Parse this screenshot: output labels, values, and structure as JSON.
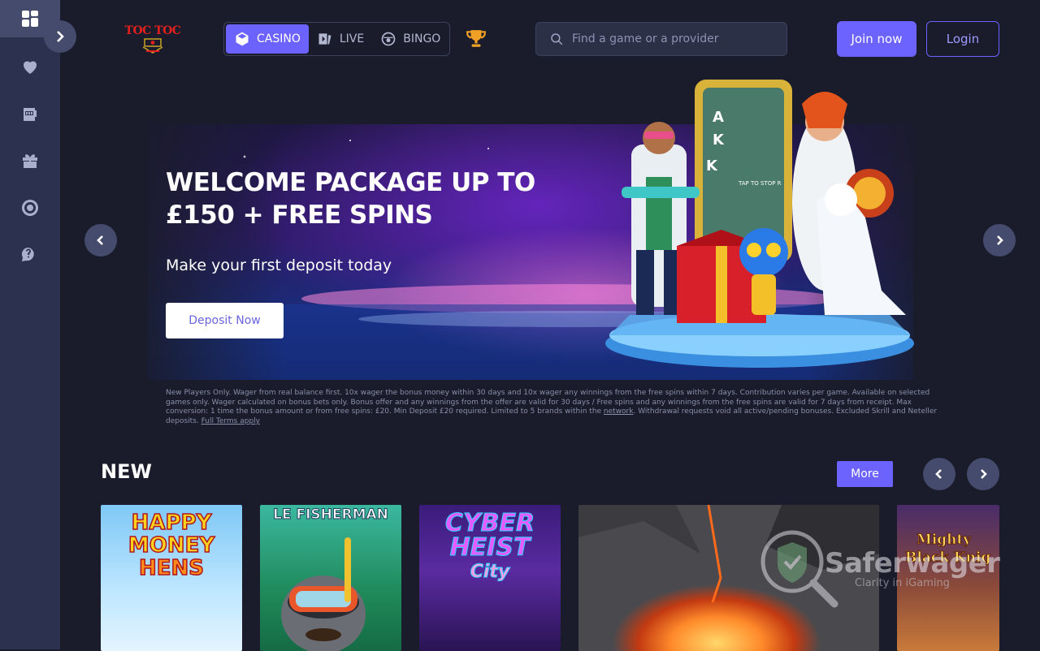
{
  "sidebar": {
    "items": [
      {
        "icon": "grid-icon"
      },
      {
        "icon": "heart-icon"
      },
      {
        "icon": "slot-machine-icon"
      },
      {
        "icon": "gift-icon"
      },
      {
        "icon": "target-icon"
      },
      {
        "icon": "help-chat-icon"
      }
    ],
    "toggle_icon": "chevron-right-icon"
  },
  "header": {
    "logo_text": "TOC TOC",
    "tabs": [
      {
        "label": "CASINO",
        "icon": "dice-icon"
      },
      {
        "label": "LIVE",
        "icon": "live-cards-icon"
      },
      {
        "label": "BINGO",
        "icon": "bingo-ball-icon"
      }
    ],
    "trophy_icon": "trophy-icon",
    "search": {
      "placeholder": "Find a game or a provider"
    },
    "join_label": "Join now",
    "login_label": "Login"
  },
  "banner": {
    "title_line1": "WELCOME PACKAGE UP TO",
    "title_line2": "£150 + FREE SPINS",
    "subtitle": "Make your first deposit today",
    "cta": "Deposit Now",
    "phone_reels": [
      "A",
      "K",
      "K"
    ],
    "phone_text": "TAP TO STOP R"
  },
  "terms": {
    "text_part1": "New Players Only. Wager from real balance first. 10x wager the bonus money within 30 days and 10x wager any winnings from the free spins within 7 days. Contribution varies per game. Available on selected games only. Wager calculated on bonus bets only. Bonus offer and any winnings from the offer are valid for 30 days / Free spins and any winnings from the free spins are valid for 7 days from receipt. Max conversion: 1 time the bonus amount or from free spins: £20. Min Deposit £20 required. Limited to 5 brands within the ",
    "link_network": "network",
    "text_part2": ". Withdrawal requests void all active/pending bonuses. Excluded Skrill and Neteller deposits. ",
    "link_terms": "Full Terms apply"
  },
  "new_section": {
    "title": "NEW",
    "more_label": "More",
    "games": [
      {
        "title_line1": "HAPPY",
        "title_line2": "MONEY",
        "title_line3": "HENS"
      },
      {
        "title": "LE FISHERMAN"
      },
      {
        "title_line1": "CYBER",
        "title_line2": "HEIST",
        "title_line3": "City"
      },
      {
        "title": ""
      },
      {
        "title_line1": "Mighty",
        "title_line2": "Black Knig"
      }
    ]
  },
  "watermark": {
    "name": "Saferwager",
    "tagline": "Clarity in iGaming"
  },
  "colors": {
    "accent": "#6c63ff",
    "background": "#1a1c2b",
    "sidebar": "#2c3150"
  }
}
